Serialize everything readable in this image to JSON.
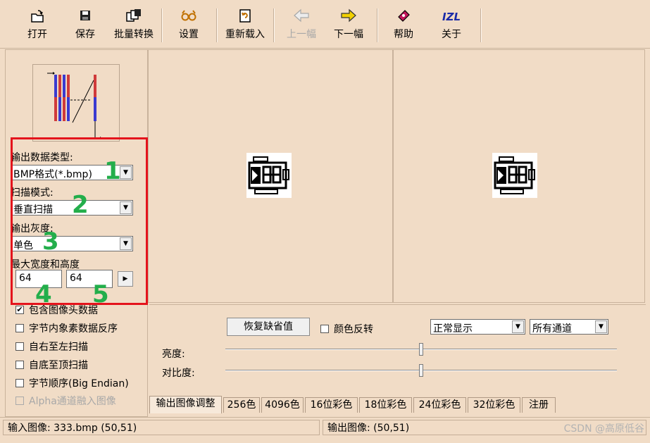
{
  "toolbar": {
    "open": "打开",
    "save": "保存",
    "batch": "批量转换",
    "settings": "设置",
    "reload": "重新载入",
    "prev": "上一幅",
    "next": "下一幅",
    "help": "帮助",
    "about": "关于",
    "about_icon_text": "IZL"
  },
  "left": {
    "output_type_label": "输出数据类型:",
    "output_type_value": "BMP格式(*.bmp)",
    "scan_mode_label": "扫描模式:",
    "scan_mode_value": "垂直扫描",
    "gray_label": "输出灰度:",
    "gray_value": "单色",
    "size_label": "最大宽度和高度",
    "width_value": "64",
    "height_value": "64",
    "annotations": [
      "1",
      "2",
      "3",
      "4",
      "5"
    ],
    "checkboxes": [
      {
        "label": "包含图像头数据",
        "checked": true,
        "disabled": false
      },
      {
        "label": "字节内象素数据反序",
        "checked": false,
        "disabled": false
      },
      {
        "label": "自右至左扫描",
        "checked": false,
        "disabled": false
      },
      {
        "label": "自底至顶扫描",
        "checked": false,
        "disabled": false
      },
      {
        "label": "字节顺序(Big Endian)",
        "checked": false,
        "disabled": false
      },
      {
        "label": "Alpha通道融入图像",
        "checked": false,
        "disabled": true
      }
    ]
  },
  "controls": {
    "restore_button": "恢复缺省值",
    "invert_label": "颜色反转",
    "display_mode": "正常显示",
    "channel": "所有通道",
    "brightness_label": "亮度:",
    "contrast_label": "对比度:",
    "brightness_value": 0.5,
    "contrast_value": 0.5
  },
  "tabs": [
    "输出图像调整",
    "256色",
    "4096色",
    "16位彩色",
    "18位彩色",
    "24位彩色",
    "32位彩色",
    "注册"
  ],
  "status": {
    "input": "输入图像: 333.bmp (50,51)",
    "output": "输出图像: (50,51)"
  },
  "watermark": "CSDN @高原低谷"
}
